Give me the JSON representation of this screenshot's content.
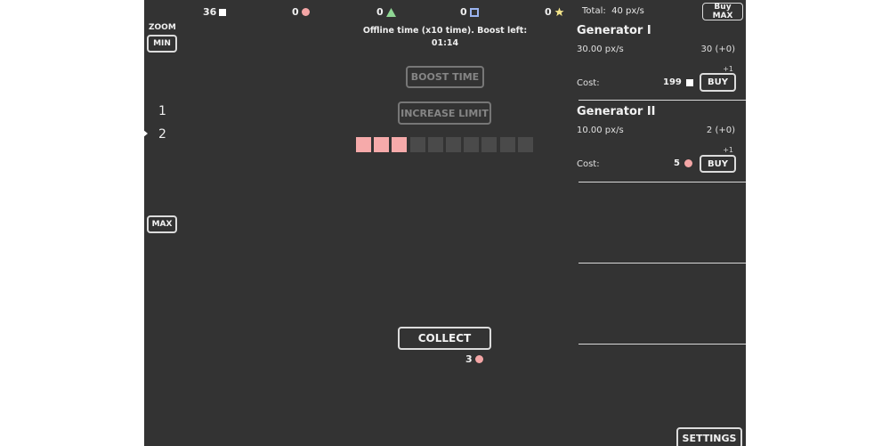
{
  "resources": [
    {
      "count": "36",
      "icon": "white-square-icon"
    },
    {
      "count": "0",
      "icon": "pink-circle-icon"
    },
    {
      "count": "0",
      "icon": "green-triangle-icon"
    },
    {
      "count": "0",
      "icon": "blue-square-icon"
    },
    {
      "count": "0",
      "icon": "yellow-star-icon"
    }
  ],
  "total": {
    "label": "Total:",
    "value": "40 px/s"
  },
  "buy_max_label": "Buy MAX",
  "zoom": {
    "title": "ZOOM",
    "min_label": "MIN",
    "max_label": "MAX",
    "levels": [
      "1",
      "2"
    ],
    "selected": "2"
  },
  "offline": {
    "text": "Offline time (x10 time). Boost left:",
    "time_left": "01:14"
  },
  "boost_label": "BOOST TIME",
  "increase_limit_label": "INCREASE LIMIT",
  "boost_slots": {
    "filled": 3,
    "total": 10
  },
  "collect": {
    "label": "COLLECT",
    "amount": "3"
  },
  "generators": [
    {
      "name": "Generator I",
      "rate": "30.00 px/s",
      "count": "30 (+0)",
      "plus": "+1",
      "cost_label": "Cost:",
      "cost": "199",
      "cost_icon": "white-square-icon",
      "buy_label": "BUY"
    },
    {
      "name": "Generator II",
      "rate": "10.00 px/s",
      "count": "2 (+0)",
      "plus": "+1",
      "cost_label": "Cost:",
      "cost": "5",
      "cost_icon": "pink-circle-icon",
      "buy_label": "BUY"
    }
  ],
  "settings_label": "SETTINGS",
  "colors": {
    "background": "#333333",
    "pink": "#f6aaaa",
    "green": "#8fd694",
    "blue": "#9ab3f0",
    "yellow": "#f3e48a",
    "empty_slot": "#4a4a4a"
  }
}
